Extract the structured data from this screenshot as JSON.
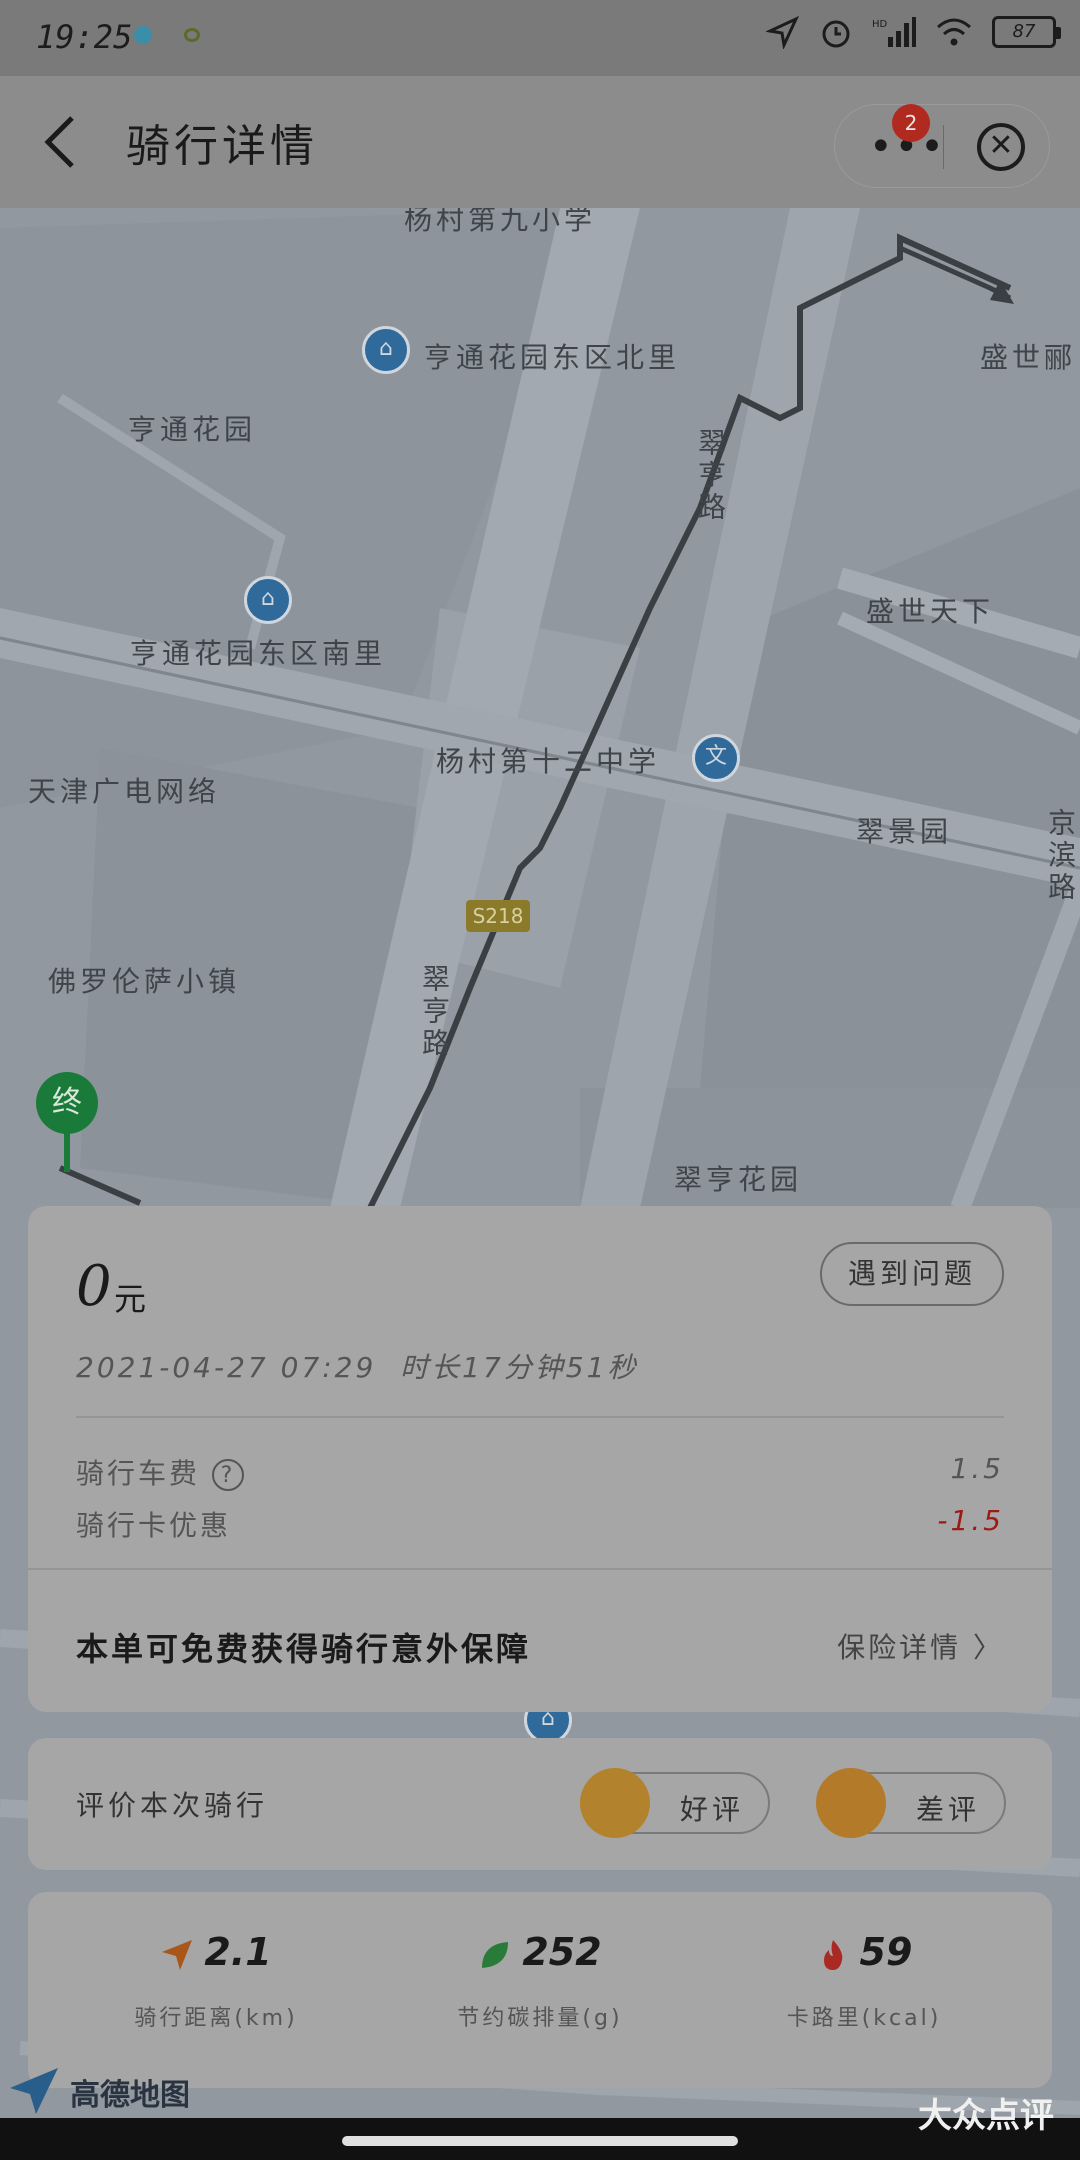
{
  "status_bar": {
    "time": "19:25",
    "battery": "87"
  },
  "header": {
    "title": "骑行详情",
    "badge_count": "2"
  },
  "map": {
    "labels": [
      "杨村第九小学",
      "亨通花园东区北里",
      "盛世郦",
      "亨通花园",
      "翠亨路",
      "亨通花园东区南里",
      "盛世天下",
      "杨村第十二中学",
      "天津广电网络",
      "翠景园",
      "佛罗伦萨小镇",
      "翠亨路",
      "翠亨花园",
      "京滨路"
    ],
    "road_badge": "S218",
    "end_marker": "终",
    "poi_school": "文"
  },
  "ride": {
    "price": "0",
    "price_unit": "元",
    "problem_button": "遇到问题",
    "datetime": "2021-04-27 07:29",
    "duration": "时长17分钟51秒",
    "fees": [
      {
        "label": "骑行车费",
        "value": "1.5"
      },
      {
        "label": "骑行卡优惠",
        "value": "-1.5"
      }
    ],
    "insurance_text": "本单可免费获得骑行意外保障",
    "insurance_link": "保险详情"
  },
  "rating": {
    "label": "评价本次骑行",
    "good": "好评",
    "bad": "差评"
  },
  "stats": [
    {
      "value": "2.1",
      "label": "骑行距离(km)",
      "icon": "navigation-arrow-icon"
    },
    {
      "value": "252",
      "label": "节约碳排量(g)",
      "icon": "leaf-icon"
    },
    {
      "value": "59",
      "label": "卡路里(kcal)",
      "icon": "flame-icon"
    }
  ],
  "watermarks": {
    "amap": "高德地图",
    "dianping": "大众点评"
  },
  "colors": {
    "discount": "#9c1a14",
    "end_marker": "#1a7a3a",
    "poi": "#2f6a9a"
  }
}
